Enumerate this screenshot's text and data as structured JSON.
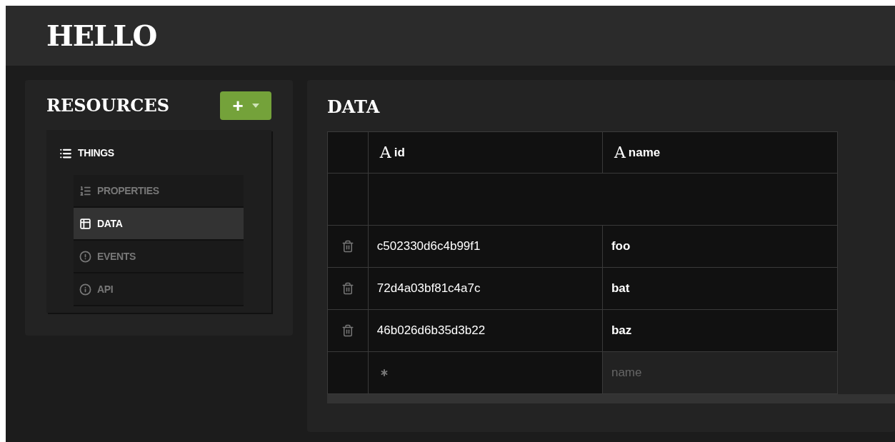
{
  "header": {
    "title": "HELLO"
  },
  "sidebar": {
    "title": "RESOURCES",
    "add_button": "+",
    "resource": {
      "label": "THINGS",
      "children": [
        {
          "label": "PROPERTIES",
          "selected": false
        },
        {
          "label": "DATA",
          "selected": true
        },
        {
          "label": "EVENTS",
          "selected": false
        },
        {
          "label": "API",
          "selected": false
        }
      ]
    }
  },
  "main": {
    "title": "DATA",
    "table": {
      "columns": [
        {
          "type_glyph": "A",
          "label": "id"
        },
        {
          "type_glyph": "A",
          "label": "name"
        }
      ],
      "rows": [
        [
          "c502330d6c4b99f1",
          "foo"
        ],
        [
          "72d4a03bf81c4a7c",
          "bat"
        ],
        [
          "46b026d6b35d3b22",
          "baz"
        ]
      ],
      "new_row": {
        "placeholder": "name"
      }
    }
  }
}
